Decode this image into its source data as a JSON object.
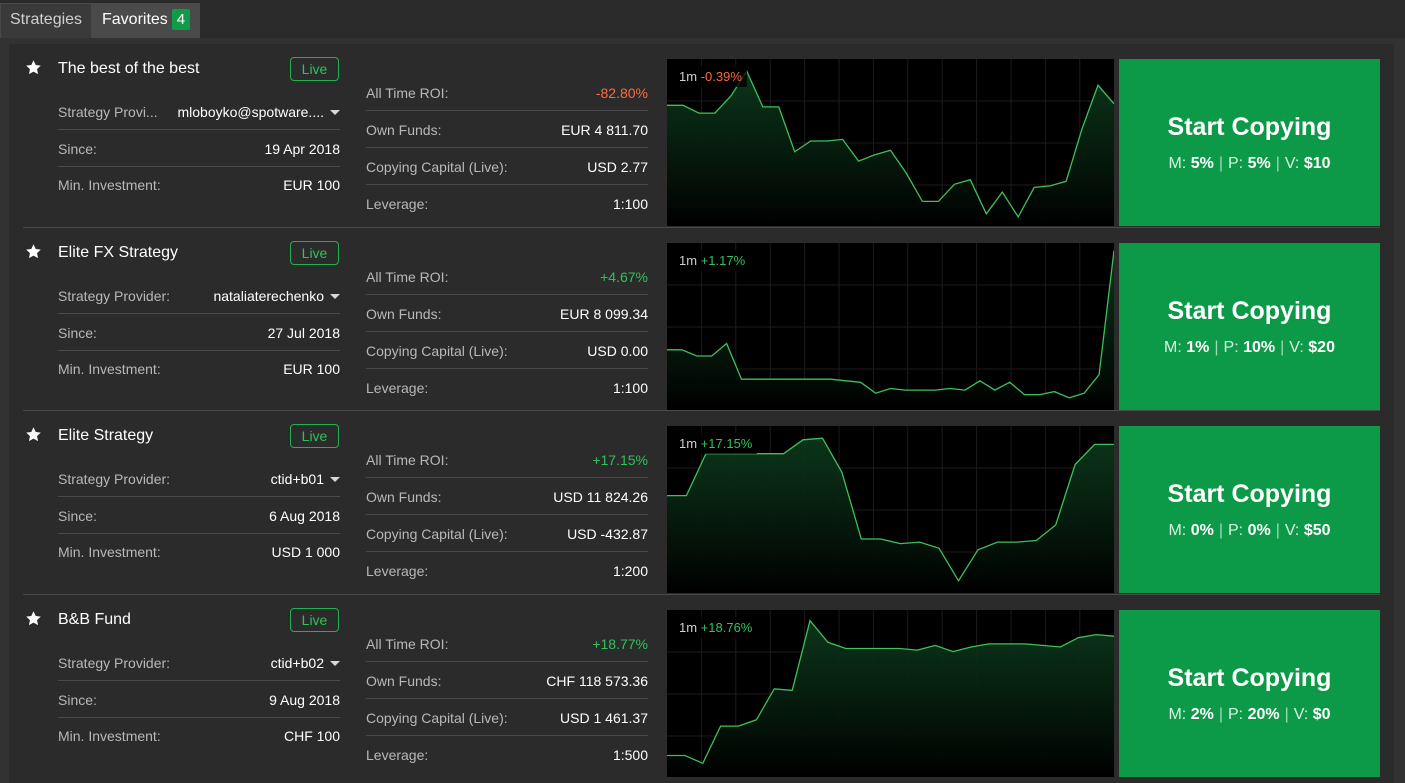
{
  "tabs": [
    {
      "label": "Strategies",
      "active": false
    },
    {
      "label": "Favorites",
      "active": true,
      "count": "4"
    }
  ],
  "labels": {
    "provider": "Strategy Provider:",
    "provider_short": "Strategy Provi...",
    "since": "Since:",
    "min_investment": "Min. Investment:",
    "roi": "All Time ROI:",
    "own_funds": "Own Funds:",
    "copying_capital": "Copying Capital (Live):",
    "leverage": "Leverage:",
    "live": "Live",
    "start_copying": "Start Copying",
    "m": "M:",
    "p": "P:",
    "v": "V:",
    "period": "1m"
  },
  "colors": {
    "accent_green": "#0d9a48",
    "positive": "#2fc25c",
    "negative": "#ff6a3a"
  },
  "strategies": [
    {
      "name": "The best of the best",
      "provider": "mloboyko@spotware....",
      "provider_label_short": true,
      "since": "19 Apr 2018",
      "min_investment": "EUR 100",
      "roi": "-82.80%",
      "roi_positive": false,
      "own_funds": "EUR 4 811.70",
      "copying_capital": "USD 2.77",
      "leverage": "1:100",
      "chart_change": "-0.39%",
      "chart_positive": false,
      "m": "5%",
      "p": "5%",
      "v": "$10",
      "series": [
        0.74,
        0.74,
        0.69,
        0.69,
        0.8,
        0.96,
        0.73,
        0.73,
        0.44,
        0.51,
        0.51,
        0.52,
        0.38,
        0.42,
        0.45,
        0.3,
        0.12,
        0.12,
        0.23,
        0.26,
        0.04,
        0.18,
        0.02,
        0.21,
        0.22,
        0.25,
        0.59,
        0.87,
        0.75
      ]
    },
    {
      "name": "Elite FX Strategy",
      "provider": "nataliaterechenko",
      "provider_label_short": false,
      "since": "27 Jul 2018",
      "min_investment": "EUR 100",
      "roi": "+4.67%",
      "roi_positive": true,
      "own_funds": "EUR 8 099.34",
      "copying_capital": "USD 0.00",
      "leverage": "1:100",
      "chart_change": "+1.17%",
      "chart_positive": true,
      "m": "1%",
      "p": "10%",
      "v": "$20",
      "series": [
        0.35,
        0.35,
        0.31,
        0.31,
        0.39,
        0.16,
        0.16,
        0.16,
        0.16,
        0.16,
        0.16,
        0.16,
        0.15,
        0.14,
        0.07,
        0.1,
        0.09,
        0.09,
        0.09,
        0.1,
        0.09,
        0.15,
        0.09,
        0.14,
        0.06,
        0.06,
        0.08,
        0.04,
        0.07,
        0.19,
        0.99
      ]
    },
    {
      "name": "Elite Strategy",
      "provider": "ctid+b01",
      "provider_label_short": false,
      "since": "6 Aug 2018",
      "min_investment": "USD 1 000",
      "roi": "+17.15%",
      "roi_positive": true,
      "own_funds": "USD 11 824.26",
      "copying_capital": "USD -432.87",
      "leverage": "1:200",
      "chart_change": "+17.15%",
      "chart_positive": true,
      "m": "0%",
      "p": "0%",
      "v": "$50",
      "series": [
        0.59,
        0.59,
        0.86,
        0.86,
        0.86,
        0.86,
        0.86,
        0.95,
        0.96,
        0.74,
        0.31,
        0.31,
        0.28,
        0.29,
        0.25,
        0.04,
        0.24,
        0.29,
        0.29,
        0.3,
        0.4,
        0.79,
        0.92,
        0.92
      ]
    },
    {
      "name": "B&B Fund",
      "provider": "ctid+b02",
      "provider_label_short": false,
      "since": "9 Aug 2018",
      "min_investment": "CHF 100",
      "roi": "+18.77%",
      "roi_positive": true,
      "own_funds": "CHF 118 573.36",
      "copying_capital": "USD 1 461.37",
      "leverage": "1:500",
      "chart_change": "+18.76%",
      "chart_positive": true,
      "m": "2%",
      "p": "20%",
      "v": "$0",
      "series": [
        0.1,
        0.1,
        0.05,
        0.29,
        0.29,
        0.33,
        0.53,
        0.52,
        0.97,
        0.83,
        0.79,
        0.79,
        0.79,
        0.79,
        0.78,
        0.81,
        0.77,
        0.8,
        0.82,
        0.82,
        0.82,
        0.81,
        0.8,
        0.86,
        0.88,
        0.87
      ]
    }
  ]
}
